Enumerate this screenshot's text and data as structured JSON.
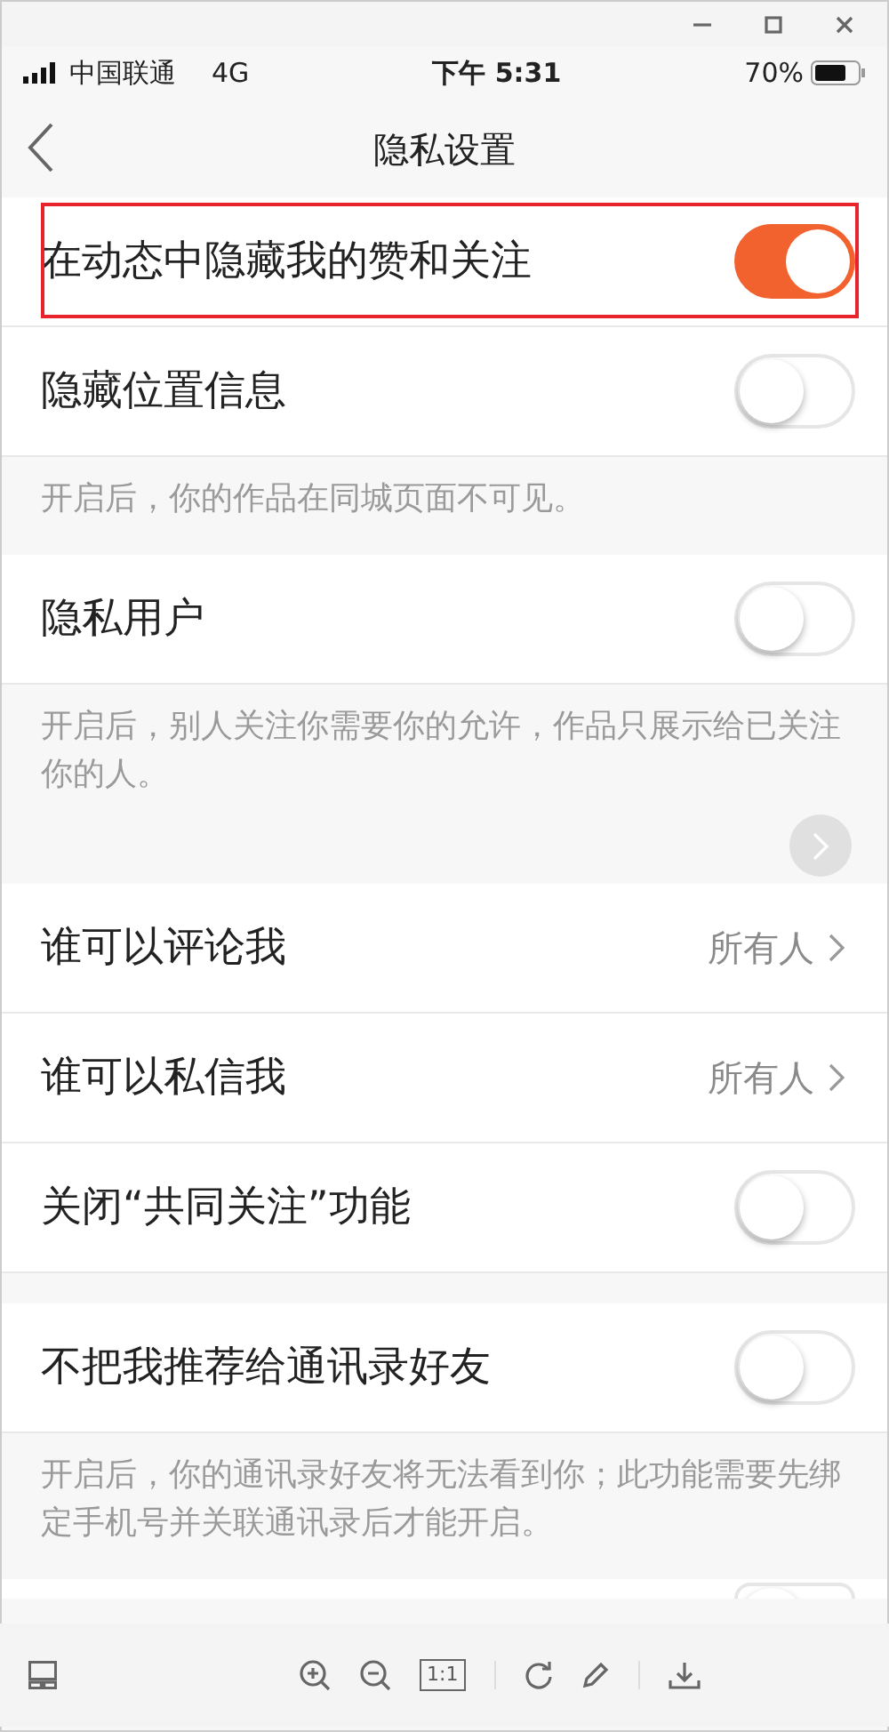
{
  "window": {
    "controls": [
      {
        "kind": "minimize"
      },
      {
        "kind": "maximize"
      },
      {
        "kind": "close"
      }
    ]
  },
  "status_bar": {
    "carrier": "中国联通",
    "network": "4G",
    "time": "下午 5:31",
    "battery": "70%"
  },
  "header": {
    "title": "隐私设置"
  },
  "items": [
    {
      "kind": "toggle",
      "label": "在动态中隐藏我的赞和关注",
      "on": true,
      "highlighted": true
    },
    {
      "kind": "toggle",
      "label": "隐藏位置信息",
      "on": false,
      "highlighted": false
    },
    {
      "kind": "note",
      "text": "开启后，你的作品在同城页面不可见。"
    },
    {
      "kind": "toggle",
      "label": "隐私用户",
      "on": false,
      "highlighted": false
    },
    {
      "kind": "note",
      "text": "开启后，别人关注你需要你的允许，作品只展示给已关注你的人。",
      "scroll_button": true
    },
    {
      "kind": "link",
      "label": "谁可以评论我",
      "value": "所有人"
    },
    {
      "kind": "link",
      "label": "谁可以私信我",
      "value": "所有人"
    },
    {
      "kind": "toggle",
      "label": "关闭“共同关注”功能",
      "on": false,
      "highlighted": false
    },
    {
      "kind": "gap"
    },
    {
      "kind": "toggle",
      "label": "不把我推荐给通讯录好友",
      "on": false,
      "highlighted": false
    },
    {
      "kind": "note",
      "text": "开启后，你的通讯录好友将无法看到你；此功能需要先绑定手机号并关联通讯录后才能开启。"
    },
    {
      "kind": "partial",
      "on": false
    }
  ],
  "viewer_toolbar": {
    "actual_size": "1:1"
  }
}
